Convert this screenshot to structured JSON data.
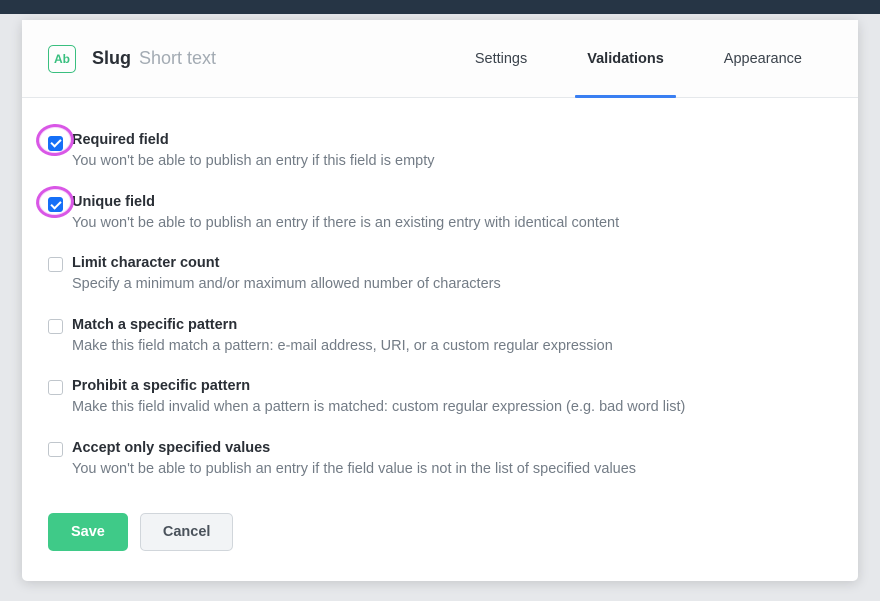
{
  "header": {
    "icon_label": "Ab",
    "title": "Slug",
    "subtitle": "Short text"
  },
  "tabs": [
    {
      "label": "Settings",
      "active": false
    },
    {
      "label": "Validations",
      "active": true
    },
    {
      "label": "Appearance",
      "active": false
    }
  ],
  "validations": [
    {
      "title": "Required field",
      "desc": "You won't be able to publish an entry if this field is empty",
      "checked": true,
      "highlighted": true
    },
    {
      "title": "Unique field",
      "desc": "You won't be able to publish an entry if there is an existing entry with identical content",
      "checked": true,
      "highlighted": true
    },
    {
      "title": "Limit character count",
      "desc": "Specify a minimum and/or maximum allowed number of characters",
      "checked": false,
      "highlighted": false
    },
    {
      "title": "Match a specific pattern",
      "desc": "Make this field match a pattern: e-mail address, URI, or a custom regular expression",
      "checked": false,
      "highlighted": false
    },
    {
      "title": "Prohibit a specific pattern",
      "desc": "Make this field invalid when a pattern is matched: custom regular expression (e.g. bad word list)",
      "checked": false,
      "highlighted": false
    },
    {
      "title": "Accept only specified values",
      "desc": "You won't be able to publish an entry if the field value is not in the list of specified values",
      "checked": false,
      "highlighted": false
    }
  ],
  "footer": {
    "save_label": "Save",
    "cancel_label": "Cancel"
  }
}
